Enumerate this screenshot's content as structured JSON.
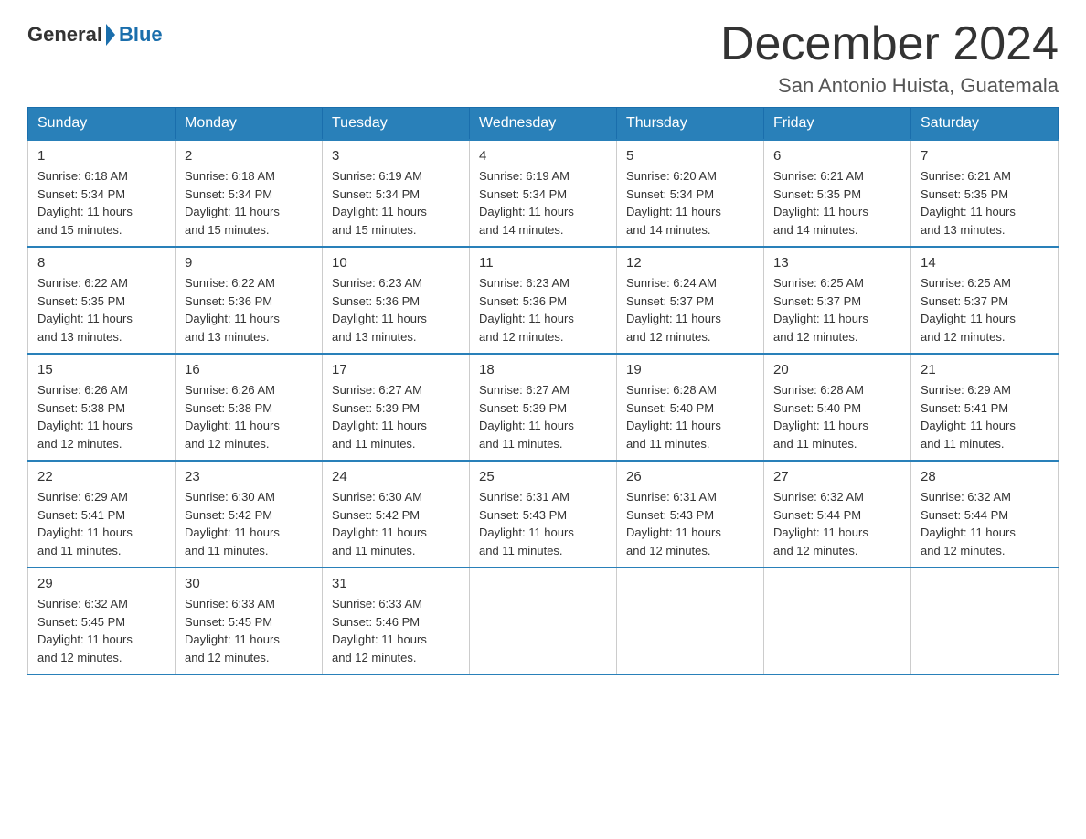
{
  "logo": {
    "general": "General",
    "blue": "Blue"
  },
  "title": "December 2024",
  "subtitle": "San Antonio Huista, Guatemala",
  "weekdays": [
    "Sunday",
    "Monday",
    "Tuesday",
    "Wednesday",
    "Thursday",
    "Friday",
    "Saturday"
  ],
  "weeks": [
    [
      {
        "day": "1",
        "sunrise": "6:18 AM",
        "sunset": "5:34 PM",
        "daylight": "11 hours and 15 minutes."
      },
      {
        "day": "2",
        "sunrise": "6:18 AM",
        "sunset": "5:34 PM",
        "daylight": "11 hours and 15 minutes."
      },
      {
        "day": "3",
        "sunrise": "6:19 AM",
        "sunset": "5:34 PM",
        "daylight": "11 hours and 15 minutes."
      },
      {
        "day": "4",
        "sunrise": "6:19 AM",
        "sunset": "5:34 PM",
        "daylight": "11 hours and 14 minutes."
      },
      {
        "day": "5",
        "sunrise": "6:20 AM",
        "sunset": "5:34 PM",
        "daylight": "11 hours and 14 minutes."
      },
      {
        "day": "6",
        "sunrise": "6:21 AM",
        "sunset": "5:35 PM",
        "daylight": "11 hours and 14 minutes."
      },
      {
        "day": "7",
        "sunrise": "6:21 AM",
        "sunset": "5:35 PM",
        "daylight": "11 hours and 13 minutes."
      }
    ],
    [
      {
        "day": "8",
        "sunrise": "6:22 AM",
        "sunset": "5:35 PM",
        "daylight": "11 hours and 13 minutes."
      },
      {
        "day": "9",
        "sunrise": "6:22 AM",
        "sunset": "5:36 PM",
        "daylight": "11 hours and 13 minutes."
      },
      {
        "day": "10",
        "sunrise": "6:23 AM",
        "sunset": "5:36 PM",
        "daylight": "11 hours and 13 minutes."
      },
      {
        "day": "11",
        "sunrise": "6:23 AM",
        "sunset": "5:36 PM",
        "daylight": "11 hours and 12 minutes."
      },
      {
        "day": "12",
        "sunrise": "6:24 AM",
        "sunset": "5:37 PM",
        "daylight": "11 hours and 12 minutes."
      },
      {
        "day": "13",
        "sunrise": "6:25 AM",
        "sunset": "5:37 PM",
        "daylight": "11 hours and 12 minutes."
      },
      {
        "day": "14",
        "sunrise": "6:25 AM",
        "sunset": "5:37 PM",
        "daylight": "11 hours and 12 minutes."
      }
    ],
    [
      {
        "day": "15",
        "sunrise": "6:26 AM",
        "sunset": "5:38 PM",
        "daylight": "11 hours and 12 minutes."
      },
      {
        "day": "16",
        "sunrise": "6:26 AM",
        "sunset": "5:38 PM",
        "daylight": "11 hours and 12 minutes."
      },
      {
        "day": "17",
        "sunrise": "6:27 AM",
        "sunset": "5:39 PM",
        "daylight": "11 hours and 11 minutes."
      },
      {
        "day": "18",
        "sunrise": "6:27 AM",
        "sunset": "5:39 PM",
        "daylight": "11 hours and 11 minutes."
      },
      {
        "day": "19",
        "sunrise": "6:28 AM",
        "sunset": "5:40 PM",
        "daylight": "11 hours and 11 minutes."
      },
      {
        "day": "20",
        "sunrise": "6:28 AM",
        "sunset": "5:40 PM",
        "daylight": "11 hours and 11 minutes."
      },
      {
        "day": "21",
        "sunrise": "6:29 AM",
        "sunset": "5:41 PM",
        "daylight": "11 hours and 11 minutes."
      }
    ],
    [
      {
        "day": "22",
        "sunrise": "6:29 AM",
        "sunset": "5:41 PM",
        "daylight": "11 hours and 11 minutes."
      },
      {
        "day": "23",
        "sunrise": "6:30 AM",
        "sunset": "5:42 PM",
        "daylight": "11 hours and 11 minutes."
      },
      {
        "day": "24",
        "sunrise": "6:30 AM",
        "sunset": "5:42 PM",
        "daylight": "11 hours and 11 minutes."
      },
      {
        "day": "25",
        "sunrise": "6:31 AM",
        "sunset": "5:43 PM",
        "daylight": "11 hours and 11 minutes."
      },
      {
        "day": "26",
        "sunrise": "6:31 AM",
        "sunset": "5:43 PM",
        "daylight": "11 hours and 12 minutes."
      },
      {
        "day": "27",
        "sunrise": "6:32 AM",
        "sunset": "5:44 PM",
        "daylight": "11 hours and 12 minutes."
      },
      {
        "day": "28",
        "sunrise": "6:32 AM",
        "sunset": "5:44 PM",
        "daylight": "11 hours and 12 minutes."
      }
    ],
    [
      {
        "day": "29",
        "sunrise": "6:32 AM",
        "sunset": "5:45 PM",
        "daylight": "11 hours and 12 minutes."
      },
      {
        "day": "30",
        "sunrise": "6:33 AM",
        "sunset": "5:45 PM",
        "daylight": "11 hours and 12 minutes."
      },
      {
        "day": "31",
        "sunrise": "6:33 AM",
        "sunset": "5:46 PM",
        "daylight": "11 hours and 12 minutes."
      },
      null,
      null,
      null,
      null
    ]
  ],
  "labels": {
    "sunrise": "Sunrise:",
    "sunset": "Sunset:",
    "daylight": "Daylight:"
  }
}
